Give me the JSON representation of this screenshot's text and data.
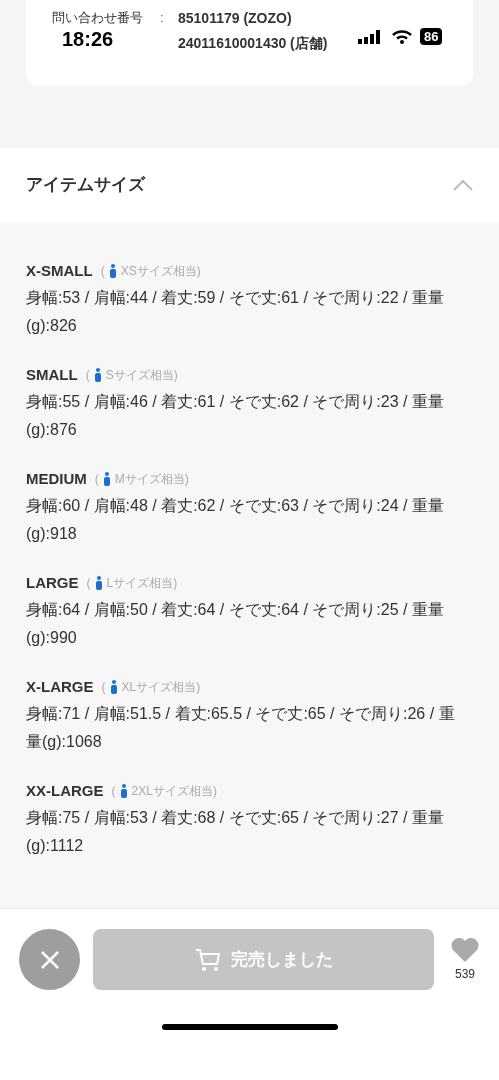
{
  "status_bar": {
    "time": "18:26",
    "battery": "86"
  },
  "inquiry": {
    "label": "問い合わせ番号",
    "separator": ":",
    "numbers": [
      "85101179 (ZOZO)",
      "24011610001430 (店舗)"
    ]
  },
  "section": {
    "title": "アイテムサイズ",
    "expanded": true
  },
  "sizes": [
    {
      "name": "X-SMALL",
      "equivalent": "XSサイズ相当",
      "paren_open": "(",
      "paren_close": ")",
      "specs": "身幅:53 / 肩幅:44 / 着丈:59 / そで丈:61 / そで周り:22 / 重量(g):826"
    },
    {
      "name": "SMALL",
      "equivalent": "Sサイズ相当",
      "paren_open": "(",
      "paren_close": ")",
      "specs": "身幅:55 / 肩幅:46 / 着丈:61 / そで丈:62 / そで周り:23 / 重量(g):876"
    },
    {
      "name": "MEDIUM",
      "equivalent": "Mサイズ相当",
      "paren_open": "(",
      "paren_close": ")",
      "specs": "身幅:60 / 肩幅:48 / 着丈:62 / そで丈:63 / そで周り:24 / 重量(g):918"
    },
    {
      "name": "LARGE",
      "equivalent": "Lサイズ相当",
      "paren_open": "(",
      "paren_close": ")",
      "specs": "身幅:64 / 肩幅:50 / 着丈:64 / そで丈:64 / そで周り:25 / 重量(g):990"
    },
    {
      "name": "X-LARGE",
      "equivalent": "XLサイズ相当",
      "paren_open": "(",
      "paren_close": ")",
      "specs": "身幅:71 / 肩幅:51.5 / 着丈:65.5 / そで丈:65 / そで周り:26 / 重量(g):1068"
    },
    {
      "name": "XX-LARGE",
      "equivalent": "2XLサイズ相当",
      "paren_open": "(",
      "paren_close": ")",
      "specs": "身幅:75 / 肩幅:53 / 着丈:68 / そで丈:65 / そで周り:27 / 重量(g):1112"
    }
  ],
  "bottom_bar": {
    "cart_button": {
      "label": "完売しました",
      "disabled": true
    },
    "favorite_count": "539"
  }
}
